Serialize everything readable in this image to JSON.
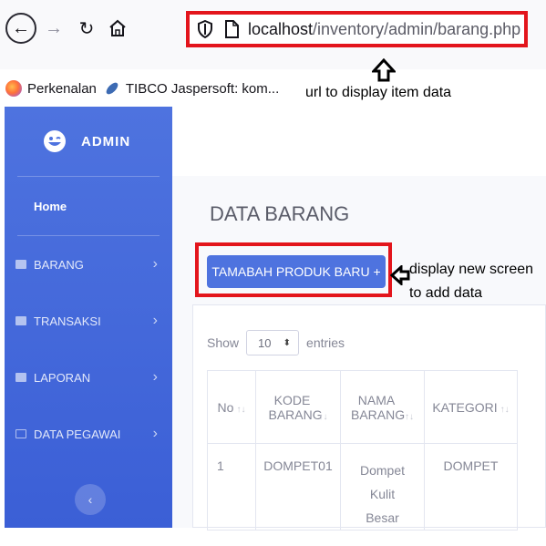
{
  "browser": {
    "url_host": "localhost",
    "url_path": "/inventory/admin/barang.php",
    "bookmarks": [
      "Perkenalan",
      "TIBCO Jaspersoft: kom..."
    ]
  },
  "annotations": {
    "url_note": "url to display item data",
    "button_note_line1": "display new screen",
    "button_note_line2": "to add data"
  },
  "sidebar": {
    "brand": "ADMIN",
    "home": "Home",
    "items": [
      {
        "label": "BARANG",
        "icon": "folder-icon"
      },
      {
        "label": "TRANSAKSI",
        "icon": "folder-icon"
      },
      {
        "label": "LAPORAN",
        "icon": "folder-icon"
      },
      {
        "label": "DATA PEGAWAI",
        "icon": "table-icon"
      }
    ],
    "collapse": "‹"
  },
  "main": {
    "title": "DATA BARANG",
    "add_button": "TAMABAH PRODUK BARU +",
    "show_label": "Show",
    "entries_value": "10",
    "entries_label": "entries",
    "table": {
      "headers": [
        "No",
        "KODE BARANG",
        "NAMA BARANG",
        "KATEGORI"
      ],
      "rows": [
        [
          "1",
          "DOMPET01",
          "Dompet Kulit Besar",
          "DOMPET"
        ]
      ]
    }
  },
  "colors": {
    "sidebar": "#4e73df",
    "button": "#4e73df",
    "annotation_frame": "#e3151c"
  }
}
